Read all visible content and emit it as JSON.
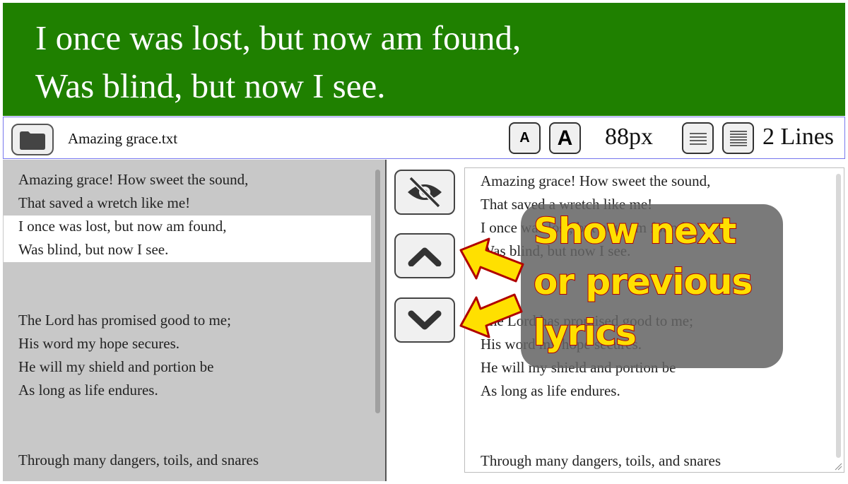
{
  "display": {
    "lines": [
      "I once was lost, but now am found,",
      "Was blind, but now I see."
    ],
    "background": "#1f8000"
  },
  "toolbar": {
    "open_icon": "folder-icon",
    "filename": "Amazing grace.txt",
    "font_smaller_label": "A",
    "font_larger_label": "A",
    "font_size": "88px",
    "lines_fewer_icon": "lines-fewer-icon",
    "lines_more_icon": "lines-more-icon",
    "lines_count": "2 Lines"
  },
  "lyrics_list": {
    "lines": [
      "Amazing grace! How sweet the sound,",
      "That saved a wretch like me!",
      "I once was lost, but now am found,",
      "Was blind, but now I see.",
      "",
      "",
      "The Lord has promised good to me;",
      "His word my hope secures.",
      "He will my shield and portion be",
      "As long as life endures.",
      "",
      "",
      "Through many dangers, toils, and snares"
    ],
    "highlighted_lines": [
      2,
      3
    ]
  },
  "controls": {
    "hide_icon": "eye-slash-icon",
    "previous_icon": "chevron-up-icon",
    "next_icon": "chevron-down-icon"
  },
  "editor": {
    "lines": [
      "Amazing grace! How sweet the sound,",
      "That saved a wretch like me!",
      "I once was lost, but now am found,",
      "Was blind, but now I see.",
      "",
      "",
      "The Lord has promised good to me;",
      "His word my hope secures.",
      "He will my shield and portion be",
      "As long as life endures.",
      "",
      "",
      "Through many dangers, toils, and snares"
    ]
  },
  "annotation": {
    "lines": [
      "Show next",
      "or previous",
      "lyrics"
    ],
    "text_color": "#ffe000",
    "outline_color": "#b00000",
    "arrow_color": "#ffe000"
  }
}
